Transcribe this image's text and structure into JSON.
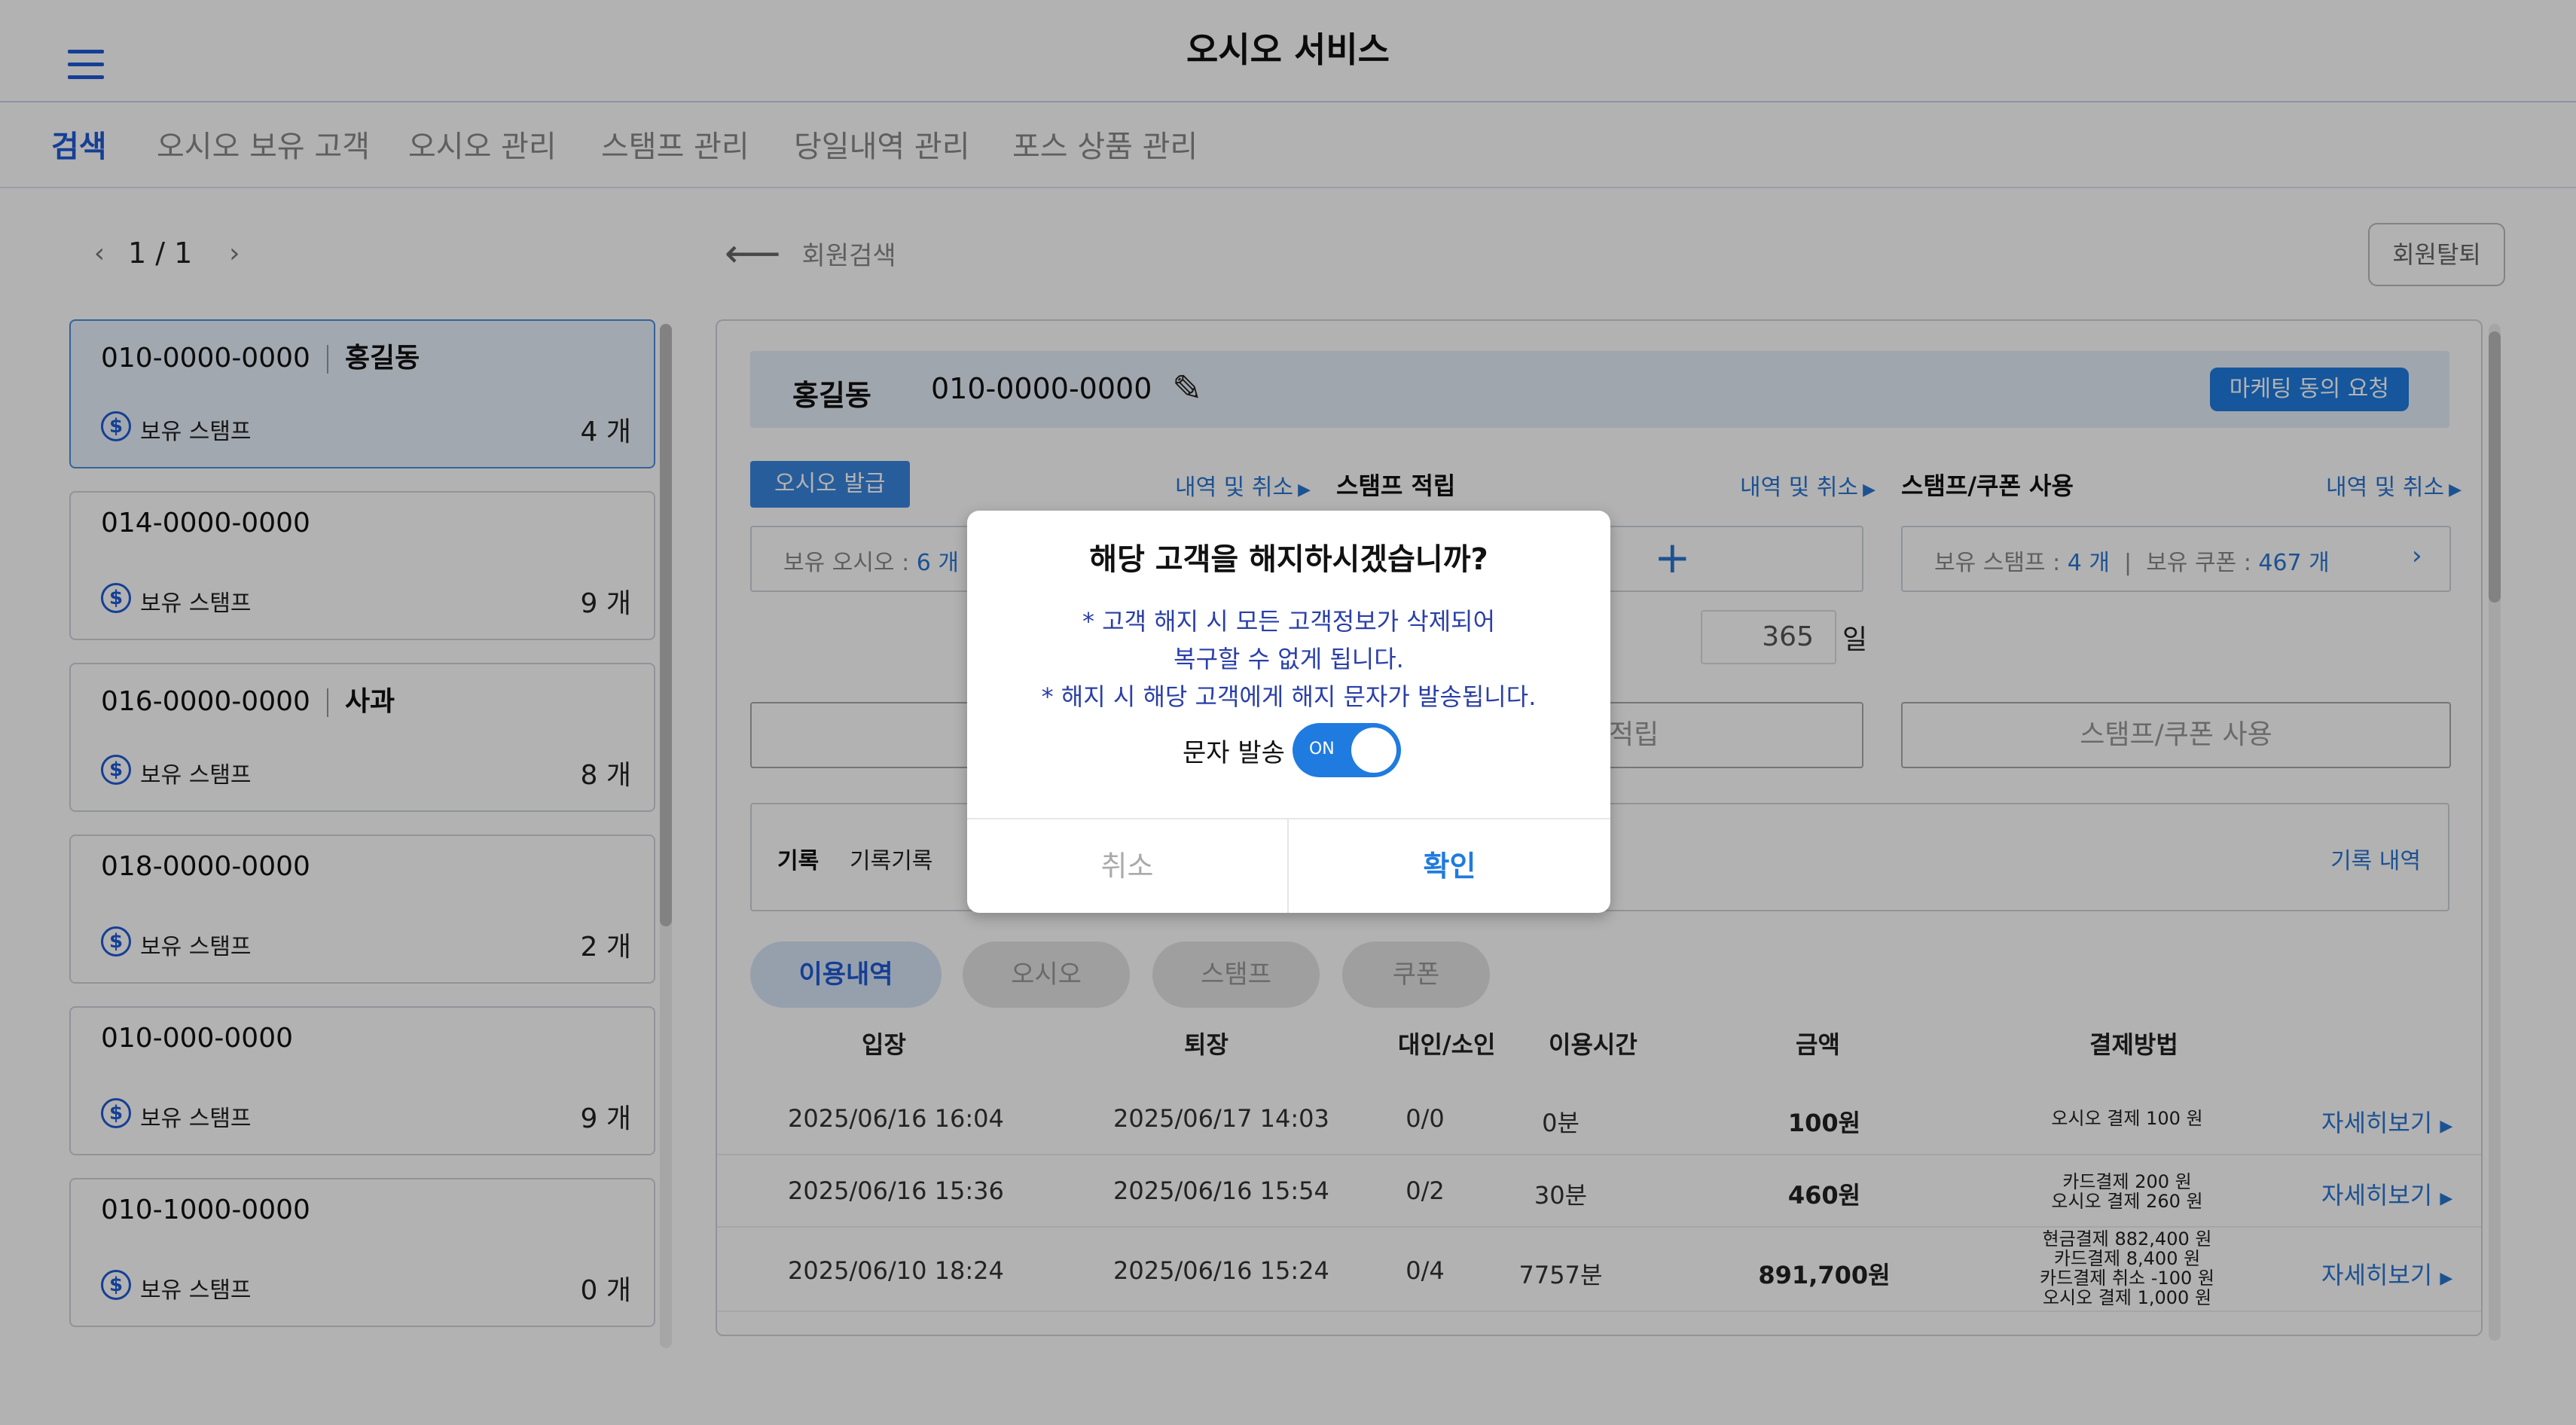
{
  "header": {
    "title": "오시오 서비스"
  },
  "tabs": [
    {
      "label": "검색"
    },
    {
      "label": "오시오 보유 고객"
    },
    {
      "label": "오시오 관리"
    },
    {
      "label": "스탬프 관리"
    },
    {
      "label": "당일내역 관리"
    },
    {
      "label": "포스 상품 관리"
    }
  ],
  "pager": {
    "page": "1 / 1",
    "prev": "‹",
    "next": "›"
  },
  "customers": [
    {
      "phone": "010-0000-0000",
      "name": "홍길동",
      "stamp_label": "보유 스탬프",
      "stamp_count": "4 개"
    },
    {
      "phone": "014-0000-0000",
      "name": "",
      "stamp_label": "보유 스탬프",
      "stamp_count": "9 개"
    },
    {
      "phone": "016-0000-0000",
      "name": "사과",
      "stamp_label": "보유 스탬프",
      "stamp_count": "8 개"
    },
    {
      "phone": "018-0000-0000",
      "name": "",
      "stamp_label": "보유 스탬프",
      "stamp_count": "2 개"
    },
    {
      "phone": "010-000-0000",
      "name": "",
      "stamp_label": "보유 스탬프",
      "stamp_count": "9 개"
    },
    {
      "phone": "010-1000-0000",
      "name": "",
      "stamp_label": "보유 스탬프",
      "stamp_count": "0 개"
    }
  ],
  "back": {
    "label": "회원검색"
  },
  "withdraw": {
    "label": "회원탈퇴"
  },
  "detail": {
    "name": "홍길동",
    "phone": "010-0000-0000",
    "marketing_button": "마케팅 동의 요청",
    "oso_issue_button": "오시오 발급",
    "history_link": "내역 및 취소",
    "stamp_earn_title": "스탬프 적립",
    "stamp_use_title": "스탬프/쿠폰 사용",
    "held_oso_label": "보유 오시오 :",
    "held_oso_value": "6 개",
    "held_stamp_label": "보유 스탬프 :",
    "held_stamp_value": "4 개",
    "held_coupon_label": "보유 쿠폰 :",
    "held_coupon_value": "467 개",
    "days_value": "365",
    "days_unit": "일",
    "earn_button_partial": "적립",
    "use_button": "스탬프/쿠폰 사용",
    "memo_key": "기록",
    "memo_value": "기록기록",
    "memo_link": "기록 내역"
  },
  "filters": [
    {
      "label": "이용내역"
    },
    {
      "label": "오시오"
    },
    {
      "label": "스탬프"
    },
    {
      "label": "쿠폰"
    }
  ],
  "table": {
    "headers": [
      "입장",
      "퇴장",
      "대인/소인",
      "이용시간",
      "금액",
      "결제방법"
    ],
    "rows": [
      {
        "in": "2025/06/16 16:04",
        "out": "2025/06/17 14:03",
        "people": "0/0",
        "time": "0분",
        "amount": "100원",
        "pay": [
          "오시오 결제 100 원"
        ],
        "detail": "자세히보기"
      },
      {
        "in": "2025/06/16 15:36",
        "out": "2025/06/16 15:54",
        "people": "0/2",
        "time": "30분",
        "amount": "460원",
        "pay": [
          "카드결제 200 원",
          "오시오 결제 260 원"
        ],
        "detail": "자세히보기"
      },
      {
        "in": "2025/06/10 18:24",
        "out": "2025/06/16 15:24",
        "people": "0/4",
        "time": "7757분",
        "amount": "891,700원",
        "pay": [
          "현금결제 882,400 원",
          "카드결제 8,400 원",
          "카드결제 취소 -100 원",
          "오시오 결제 1,000 원"
        ],
        "detail": "자세히보기"
      }
    ]
  },
  "modal": {
    "title": "해당 고객을 해지하시겠습니까?",
    "line1": "* 고객 해지 시 모든 고객정보가 삭제되어",
    "line2": "복구할 수 없게 됩니다.",
    "line3": "* 해지 시 해당 고객에게 해지 문자가 발송됩니다.",
    "sms_label": "문자 발송",
    "toggle_state": "ON",
    "cancel": "취소",
    "confirm": "확인"
  },
  "colors": {
    "accent": "#1f7be0",
    "brand": "#1f5bd6",
    "modal_text": "#2a3fa8"
  }
}
